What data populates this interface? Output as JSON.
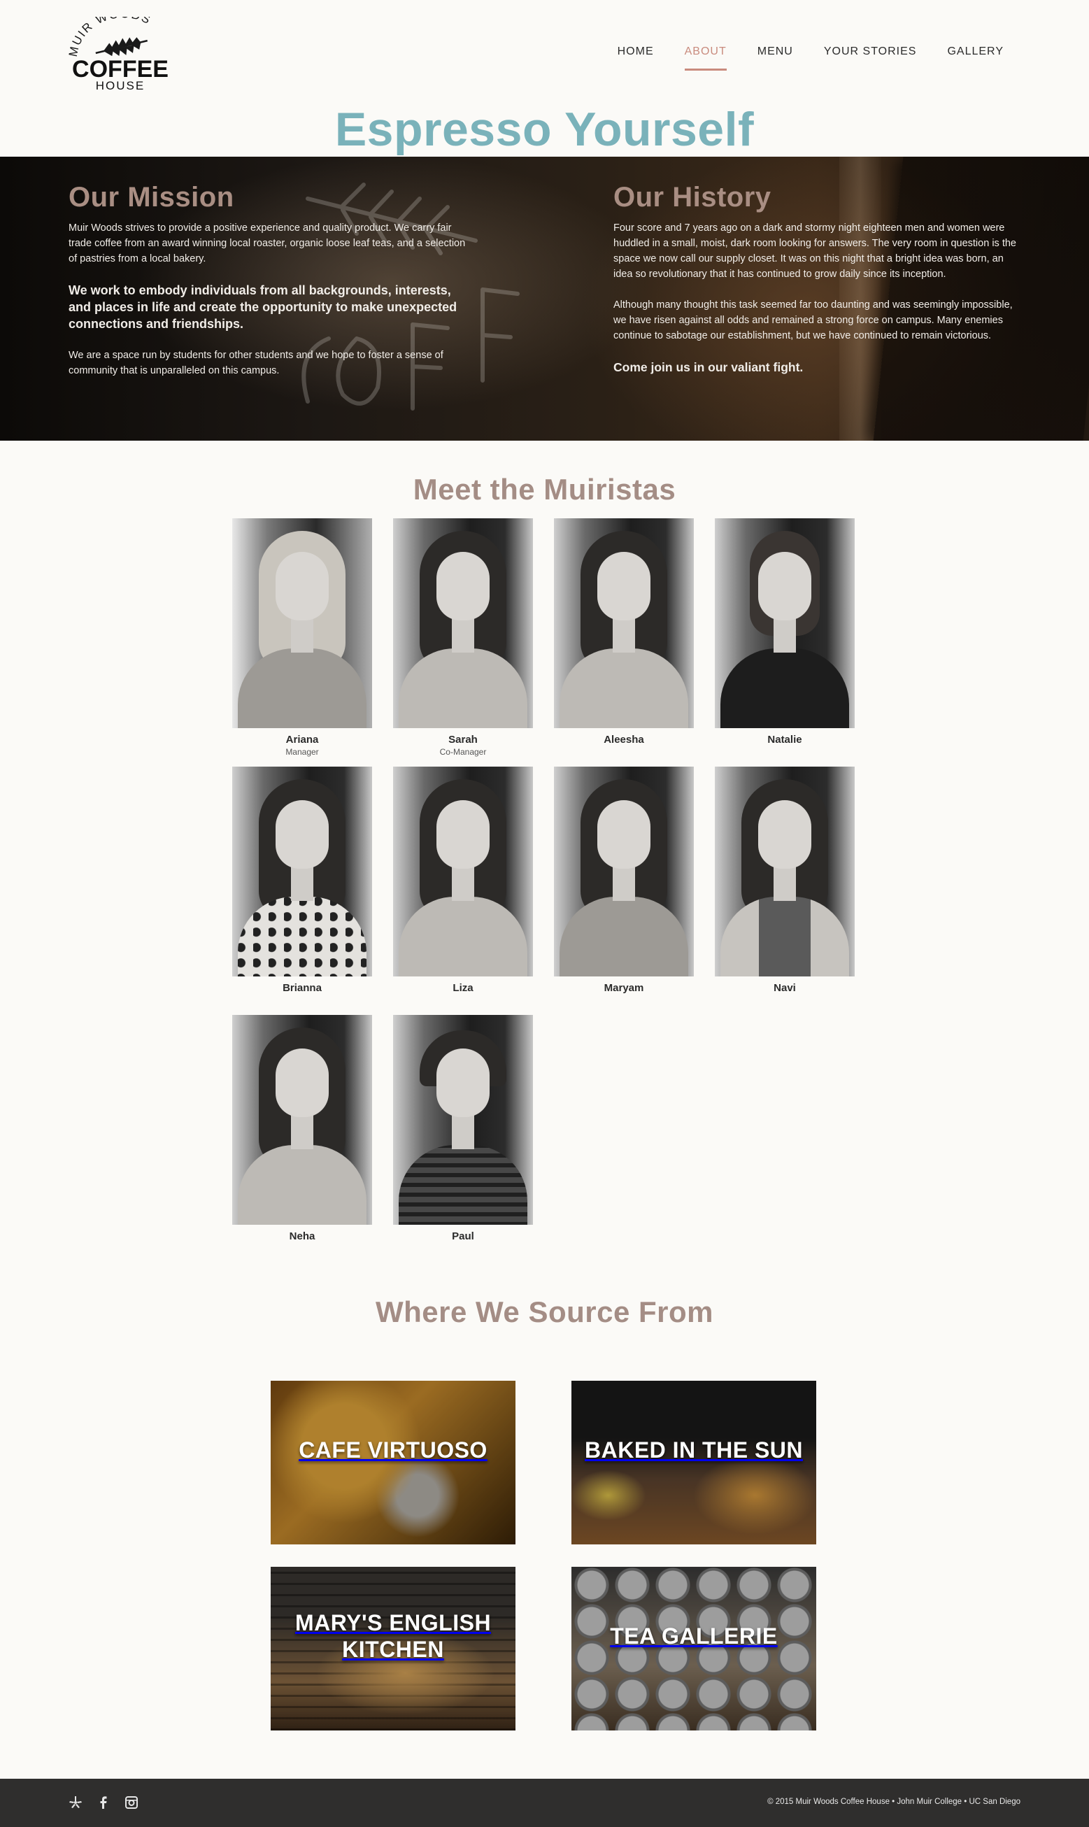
{
  "brand": {
    "logo_top": "MUIR WOODS",
    "logo_main": "COFFEE",
    "logo_bottom": "HOUSE"
  },
  "nav": {
    "items": [
      {
        "label": "HOME",
        "active": false
      },
      {
        "label": "ABOUT",
        "active": true
      },
      {
        "label": "MENU",
        "active": false
      },
      {
        "label": "YOUR STORIES",
        "active": false
      },
      {
        "label": "GALLERY",
        "active": false
      }
    ]
  },
  "page": {
    "title": "Espresso Yourself"
  },
  "mission": {
    "heading": "Our Mission",
    "p1": "Muir Woods strives to provide a positive experience and quality product. We carry fair trade coffee from an award winning local roaster, organic loose leaf teas, and a selection of pastries from a local bakery.",
    "p2": "We work to embody individuals from all backgrounds, interests, and places in life and create the opportunity to make unexpected connections and friendships.",
    "p3": "We are a space run by students for other students and we hope to foster a sense of community that is unparalleled on this campus."
  },
  "history": {
    "heading": "Our History",
    "p1": "Four score and 7 years ago on a dark and stormy night eighteen men and women were huddled in a small, moist, dark room looking for answers. The very room in question is the space we now call our supply closet. It was on this night that a bright idea was born, an idea so revolutionary that it has continued to grow daily since its inception.",
    "p2": "Although many thought this task seemed far too daunting and was seemingly impossible, we have risen against all odds and remained a strong force on campus. Many enemies continue to sabotage our establishment, but we have continued to remain victorious.",
    "p3": "Come join us in our valiant fight."
  },
  "team": {
    "heading": "Meet the Muiristas",
    "members": [
      {
        "name": "Ariana",
        "role": "Manager"
      },
      {
        "name": "Sarah",
        "role": "Co-Manager"
      },
      {
        "name": "Aleesha",
        "role": ""
      },
      {
        "name": "Natalie",
        "role": ""
      },
      {
        "name": "Brianna",
        "role": ""
      },
      {
        "name": "Liza",
        "role": ""
      },
      {
        "name": "Maryam",
        "role": ""
      },
      {
        "name": "Navi",
        "role": ""
      },
      {
        "name": "Neha",
        "role": ""
      },
      {
        "name": "Paul",
        "role": ""
      }
    ]
  },
  "sources": {
    "heading": "Where We Source From",
    "items": [
      {
        "label": "CAFE VIRTUOSO"
      },
      {
        "label": "BAKED IN THE SUN"
      },
      {
        "label": "MARY'S ENGLISH KITCHEN"
      },
      {
        "label": "TEA GALLERIE"
      }
    ]
  },
  "footer": {
    "icons": [
      "yelp-icon",
      "facebook-icon",
      "instagram-icon"
    ],
    "copyright": "© 2015 Muir Woods Coffee House  •  John Muir College  •  UC San Diego"
  },
  "colors": {
    "accent_teal": "#7ab2ba",
    "accent_rose": "#c98b7e",
    "heading_mauve": "#a48d85",
    "footer_bg": "#2f2e2d"
  }
}
